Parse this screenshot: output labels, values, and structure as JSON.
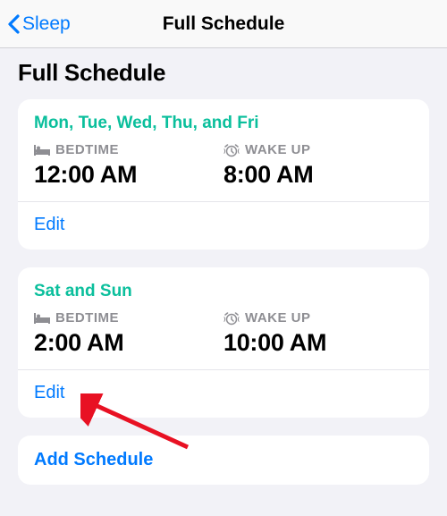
{
  "nav": {
    "back_label": "Sleep",
    "title": "Full Schedule"
  },
  "section_title": "Full Schedule",
  "schedules": [
    {
      "days": "Mon, Tue, Wed, Thu, and Fri",
      "bedtime_label": "BEDTIME",
      "bedtime_value": "12:00 AM",
      "wakeup_label": "WAKE UP",
      "wakeup_value": "8:00 AM",
      "edit_label": "Edit"
    },
    {
      "days": "Sat and Sun",
      "bedtime_label": "BEDTIME",
      "bedtime_value": "2:00 AM",
      "wakeup_label": "WAKE UP",
      "wakeup_value": "10:00 AM",
      "edit_label": "Edit"
    }
  ],
  "add_schedule_label": "Add Schedule"
}
